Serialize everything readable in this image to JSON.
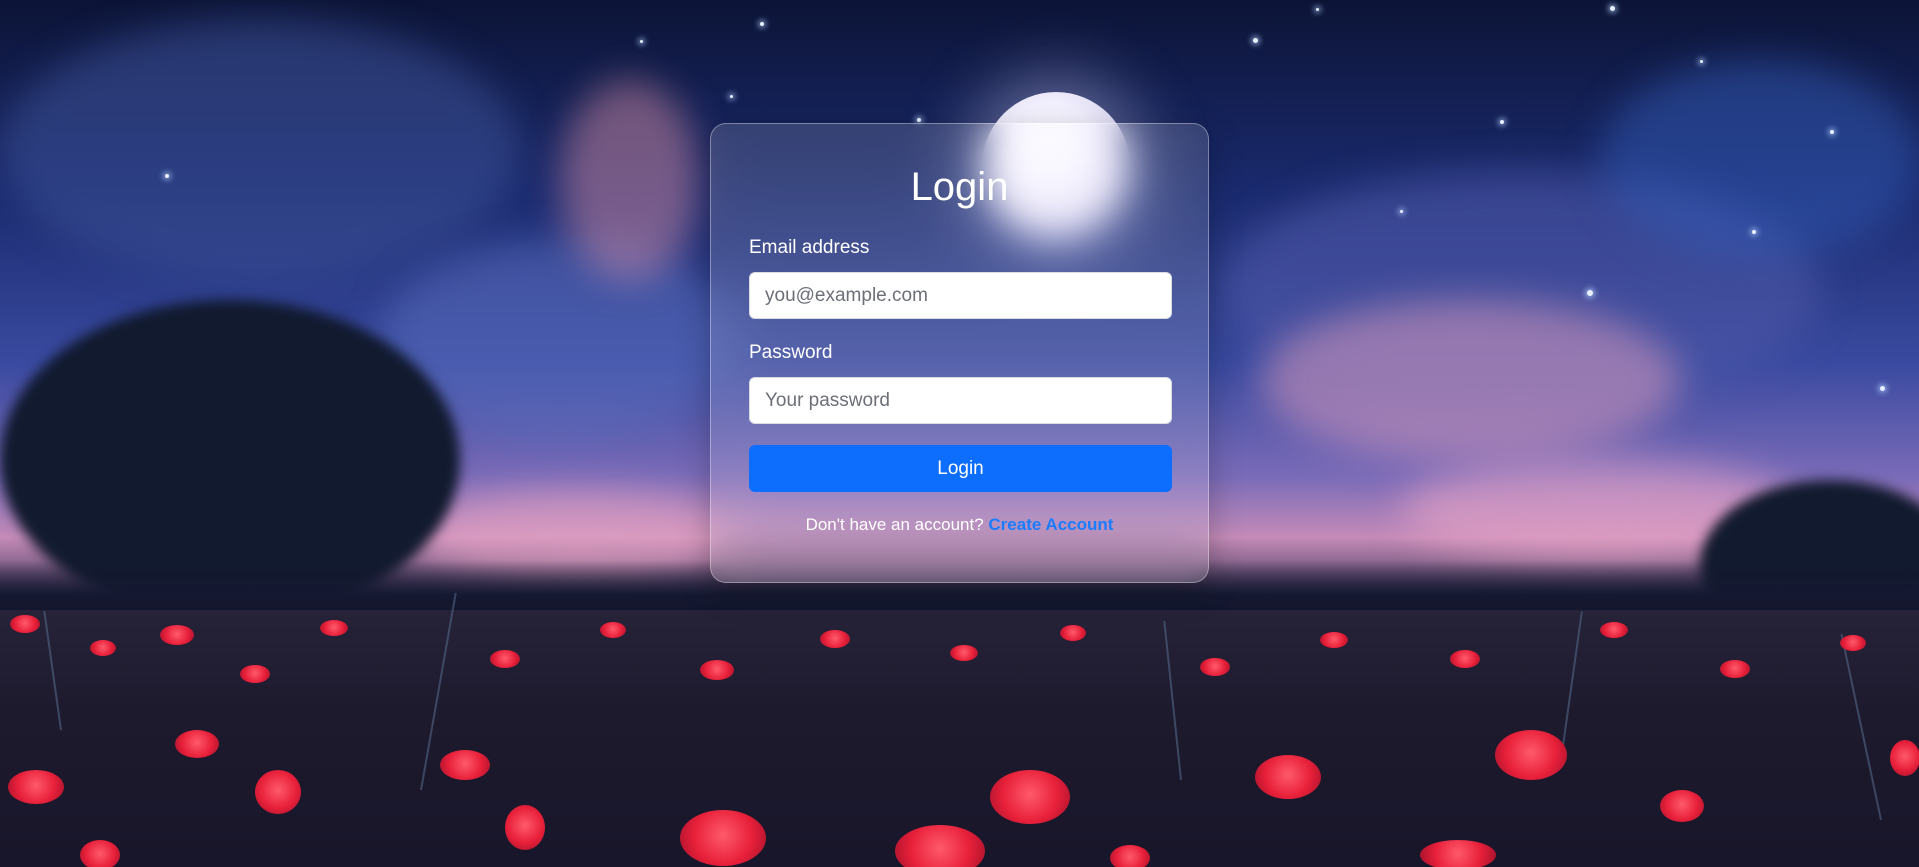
{
  "login": {
    "title": "Login",
    "email_label": "Email address",
    "email_placeholder": "you@example.com",
    "email_value": "",
    "password_label": "Password",
    "password_placeholder": "Your password",
    "password_value": "",
    "submit_label": "Login",
    "signup_prompt": "Don't have an account?",
    "signup_link": "Create Account"
  },
  "colors": {
    "primary": "#0d6efd",
    "link": "#1a7cff",
    "card_background": "rgba(255,255,255,0.14)"
  },
  "background": {
    "scene": "night-sky-poppy-field"
  }
}
